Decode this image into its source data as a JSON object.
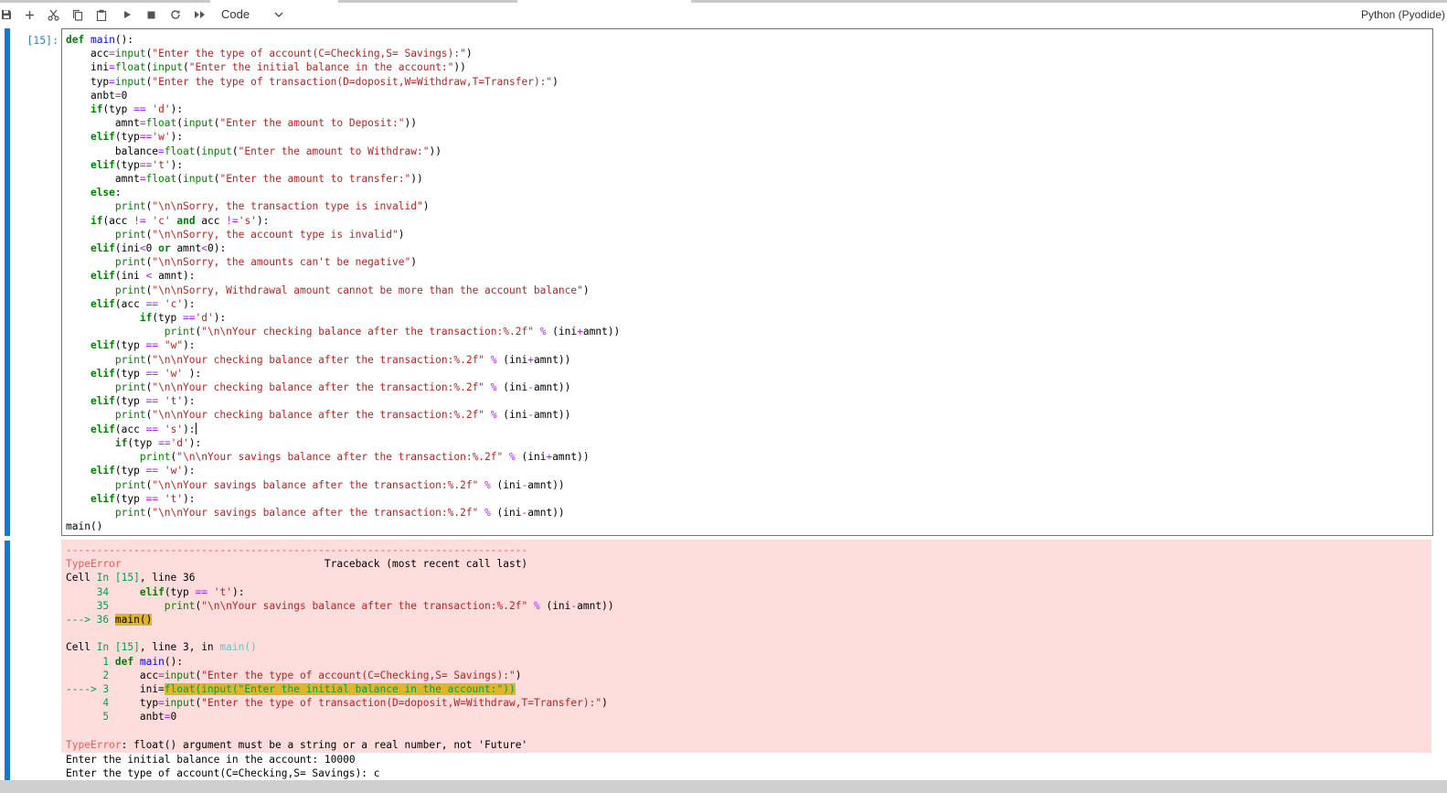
{
  "toolbar": {
    "cell_type": "Code",
    "kernel_name": "Python (Pyodide)",
    "buttons": [
      "save",
      "insert-cell",
      "cut",
      "copy",
      "paste",
      "run",
      "interrupt",
      "restart",
      "run-all"
    ]
  },
  "cell": {
    "prompt": "[15]:",
    "code_lines": [
      "def main():",
      "    acc=input(\"Enter the type of account(C=Checking,S= Savings):\")",
      "    ini=float(input(\"Enter the initial balance in the account:\"))",
      "    typ=input(\"Enter the type of transaction(D=doposit,W=Withdraw,T=Transfer):\")",
      "    anbt=0",
      "    if(typ == 'd'):",
      "        amnt=float(input(\"Enter the amount to Deposit:\"))",
      "    elif(typ=='w'):",
      "        balance=float(input(\"Enter the amount to Withdraw:\"))",
      "    elif(typ=='t'):",
      "        amnt=float(input(\"Enter the amount to transfer:\"))",
      "    else:",
      "        print(\"\\n\\nSorry, the transaction type is invalid\")",
      "    if(acc != 'c' and acc !='s'):",
      "        print(\"\\n\\nSorry, the account type is invalid\")",
      "    elif(ini<0 or amnt<0):",
      "        print(\"\\n\\nSorry, the amounts can't be negative\")",
      "    elif(ini < amnt):",
      "        print(\"\\n\\nSorry, Withdrawal amount cannot be more than the account balance\")",
      "    elif(acc == 'c'):",
      "            if(typ =='d'):",
      "                print(\"\\n\\nYour checking balance after the transaction:%.2f\" % (ini+amnt))",
      "    elif(typ == \"w\"):",
      "        print(\"\\n\\nYour checking balance after the transaction:%.2f\" % (ini+amnt))",
      "    elif(typ == 'w' ):",
      "        print(\"\\n\\nYour checking balance after the transaction:%.2f\" % (ini-amnt))",
      "    elif(typ == 't'):",
      "        print(\"\\n\\nYour checking balance after the transaction:%.2f\" % (ini-amnt))",
      "    elif(acc == 's'):",
      "        if(typ =='d'):",
      "            print(\"\\n\\nYour savings balance after the transaction:%.2f\" % (ini+amnt))",
      "    elif(typ == 'w'):",
      "        print(\"\\n\\nYour savings balance after the transaction:%.2f\" % (ini-amnt))",
      "    elif(typ == 't'):",
      "        print(\"\\n\\nYour savings balance after the transaction:%.2f\" % (ini-amnt))",
      "main()"
    ]
  },
  "output": {
    "traceback_lines": [
      "---------------------------------------------------------------------------",
      "TypeError                                 Traceback (most recent call last)",
      "Cell In [15], line 36",
      "     34     elif(typ == 't'):",
      "     35         print(\"\\n\\nYour savings balance after the transaction:%.2f\" % (ini-amnt))",
      "---> 36 main()",
      "",
      "Cell In [15], line 3, in main()",
      "      1 def main():",
      "      2     acc=input(\"Enter the type of account(C=Checking,S= Savings):\")",
      "----> 3     ini=float(input(\"Enter the initial balance in the account:\"))",
      "      4     typ=input(\"Enter the type of transaction(D=doposit,W=Withdraw,T=Transfer):\")",
      "      5     anbt=0",
      "",
      "TypeError: float() argument must be a string or a real number, not 'Future'"
    ],
    "stdout_lines": [
      "Enter the initial balance in the account: 10000",
      "Enter the type of account(C=Checking,S= Savings): c"
    ]
  },
  "colors": {
    "accent": "#1976d2",
    "error_background": "#fddcdc",
    "highlight": "#ddb62b"
  }
}
